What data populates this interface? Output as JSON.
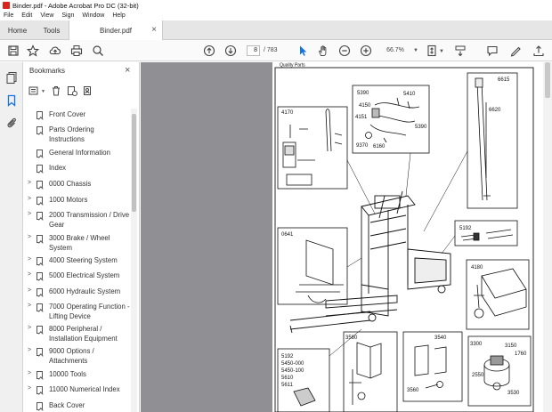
{
  "window": {
    "title": "Binder.pdf - Adobe Acrobat Pro DC (32-bit)"
  },
  "menu": [
    "File",
    "Edit",
    "View",
    "Sign",
    "Window",
    "Help"
  ],
  "tabs": {
    "home": "Home",
    "tools": "Tools",
    "document": "Binder.pdf"
  },
  "toolbar": {
    "page_current": "8",
    "page_total": "/ 783",
    "zoom": "66.7%",
    "icons": [
      "star-icon",
      "upload-icon",
      "print-icon",
      "search-icon",
      "page-up-icon",
      "page-down-icon",
      "select-cursor-icon",
      "hand-icon",
      "zoom-out-icon",
      "zoom-in-icon",
      "fit-page-icon",
      "scroll-mode-icon",
      "comment-icon",
      "sign-icon"
    ]
  },
  "bookmarks": {
    "title": "Bookmarks",
    "items": [
      {
        "label": "Front Cover",
        "expandable": false
      },
      {
        "label": "Parts Ordering Instructions",
        "expandable": false
      },
      {
        "label": "General Information",
        "expandable": false
      },
      {
        "label": "Index",
        "expandable": false
      },
      {
        "label": "0000 Chassis",
        "expandable": true
      },
      {
        "label": "1000 Motors",
        "expandable": true
      },
      {
        "label": "2000 Transmission / Drive Gear",
        "expandable": true
      },
      {
        "label": "3000 Brake / Wheel System",
        "expandable": true
      },
      {
        "label": "4000 Steering System",
        "expandable": true
      },
      {
        "label": "5000 Electrical System",
        "expandable": true
      },
      {
        "label": "6000 Hydraulic System",
        "expandable": true
      },
      {
        "label": "7000 Operating Function - Lifting Device",
        "expandable": true
      },
      {
        "label": "8000 Peripheral / Installation Equipment",
        "expandable": true
      },
      {
        "label": "9000 Options / Attachments",
        "expandable": true
      },
      {
        "label": "10000 Tools",
        "expandable": true
      },
      {
        "label": "11000 Numerical Index",
        "expandable": true
      },
      {
        "label": "Back Cover",
        "expandable": false
      }
    ]
  },
  "drawing": {
    "header": "Quality Parts",
    "callouts": {
      "c4170": "4170",
      "c5390a": "5390",
      "c5410": "5410",
      "c4150": "4150",
      "c4151": "4151",
      "c5390b": "5390",
      "c9370": "9370",
      "c6160": "6160",
      "c6615": "6615",
      "c6620": "6620",
      "c0641": "0641",
      "c5192a": "5192",
      "c4180": "4180",
      "c3580": "3580",
      "c3540": "3540",
      "c3300": "3300",
      "c3150": "3150",
      "c1760": "1760",
      "c2550": "2550",
      "c3530": "3530",
      "c3560": "3560",
      "c5192b": "5192",
      "c5450_000": "5450-000",
      "c5450_100": "5450-100",
      "c5610": "5610",
      "c5611": "5611"
    }
  }
}
